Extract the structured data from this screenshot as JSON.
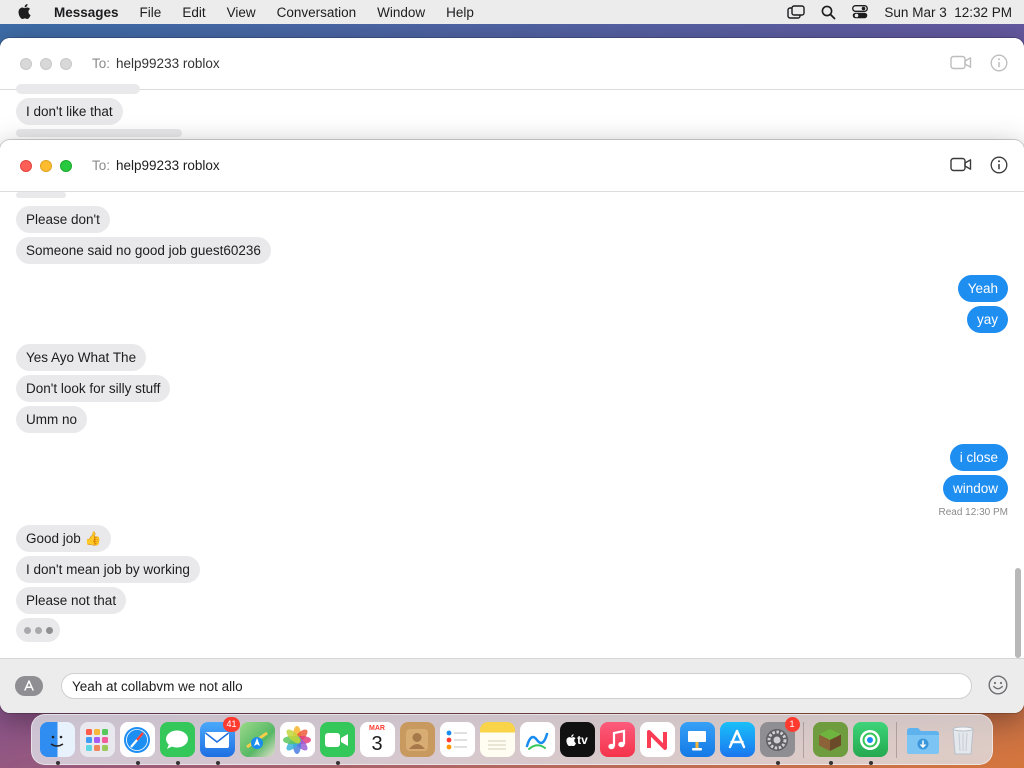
{
  "menubar": {
    "app_name": "Messages",
    "items": [
      "File",
      "Edit",
      "View",
      "Conversation",
      "Window",
      "Help"
    ],
    "clock": "Sun Mar 3  12:32 PM",
    "icons": [
      "screen-mirroring-icon",
      "search-icon",
      "control-center-icon"
    ]
  },
  "back_window": {
    "to_label": "To:",
    "recipient": "help99233 roblox",
    "messages": [
      {
        "text": "I don't like that",
        "direction": "in"
      }
    ]
  },
  "front_window": {
    "to_label": "To:",
    "recipient": "help99233 roblox",
    "messages": [
      {
        "text": "Please don't",
        "direction": "in"
      },
      {
        "text": "Someone said no good job guest60236",
        "direction": "in"
      },
      {
        "text": "Yeah",
        "direction": "out"
      },
      {
        "text": "yay",
        "direction": "out"
      },
      {
        "text": "Yes Ayo What The",
        "direction": "in"
      },
      {
        "text": "Don't look for silly stuff",
        "direction": "in"
      },
      {
        "text": "Umm no",
        "direction": "in"
      },
      {
        "text": "i close",
        "direction": "out"
      },
      {
        "text": "window",
        "direction": "out"
      },
      {
        "text": "Good job 👍",
        "direction": "in"
      },
      {
        "text": "I don't mean job by working",
        "direction": "in"
      },
      {
        "text": "Please not that",
        "direction": "in"
      }
    ],
    "read_receipt": "Read 12:30 PM",
    "composer_value": "Yeah at collabvm we not allo"
  },
  "dock": {
    "apps": [
      {
        "name": "Finder",
        "icon": "finder-icon",
        "color": "#2f8cf0",
        "running": true
      },
      {
        "name": "Launchpad",
        "icon": "launchpad-icon",
        "color": "#e8e8ee",
        "running": false
      },
      {
        "name": "Safari",
        "icon": "safari-icon",
        "color": "#1d8ef2",
        "running": true
      },
      {
        "name": "Messages",
        "icon": "messages-icon",
        "color": "#34c759",
        "running": true
      },
      {
        "name": "Mail",
        "icon": "mail-icon",
        "color": "#1e88f5",
        "running": true,
        "badge": "41"
      },
      {
        "name": "Maps",
        "icon": "maps-icon",
        "color": "#56b865",
        "running": false
      },
      {
        "name": "Photos",
        "icon": "photos-icon",
        "color": "#ffffff",
        "running": false
      },
      {
        "name": "FaceTime",
        "icon": "facetime-icon",
        "color": "#34c759",
        "running": true
      },
      {
        "name": "Calendar",
        "icon": "calendar-icon",
        "color": "#ffffff",
        "running": false,
        "month": "MAR",
        "day": "3"
      },
      {
        "name": "Contacts",
        "icon": "contacts-icon",
        "color": "#c99a5f",
        "running": false
      },
      {
        "name": "Reminders",
        "icon": "reminders-icon",
        "color": "#ffffff",
        "running": false
      },
      {
        "name": "Notes",
        "icon": "notes-icon",
        "color": "#f9d448",
        "running": false
      },
      {
        "name": "Freeform",
        "icon": "freeform-icon",
        "color": "#ffffff",
        "running": false
      },
      {
        "name": "TV",
        "icon": "tv-icon",
        "color": "#111111",
        "running": false,
        "label": "tv"
      },
      {
        "name": "Music",
        "icon": "music-icon",
        "color": "#fb3c4e",
        "running": false
      },
      {
        "name": "News",
        "icon": "news-icon",
        "color": "#ffffff",
        "running": false
      },
      {
        "name": "Keynote",
        "icon": "keynote-icon",
        "color": "#1b8ef2",
        "running": false
      },
      {
        "name": "App Store",
        "icon": "app-store-icon",
        "color": "#1a8cf0",
        "running": false
      },
      {
        "name": "System Settings",
        "icon": "settings-icon",
        "color": "#8e8e93",
        "running": true,
        "badge": "1"
      }
    ],
    "recent_apps": [
      {
        "name": "Minecraft",
        "icon": "minecraft-icon",
        "color": "#6e9c3e",
        "running": true
      },
      {
        "name": "Find My",
        "icon": "find-my-icon",
        "color": "#33c262",
        "running": true
      }
    ],
    "folders": [
      {
        "name": "Downloads",
        "icon": "downloads-folder-icon",
        "color": "#5eb3ee"
      },
      {
        "name": "Trash",
        "icon": "trash-icon",
        "color": "#dfe3e8"
      }
    ]
  }
}
